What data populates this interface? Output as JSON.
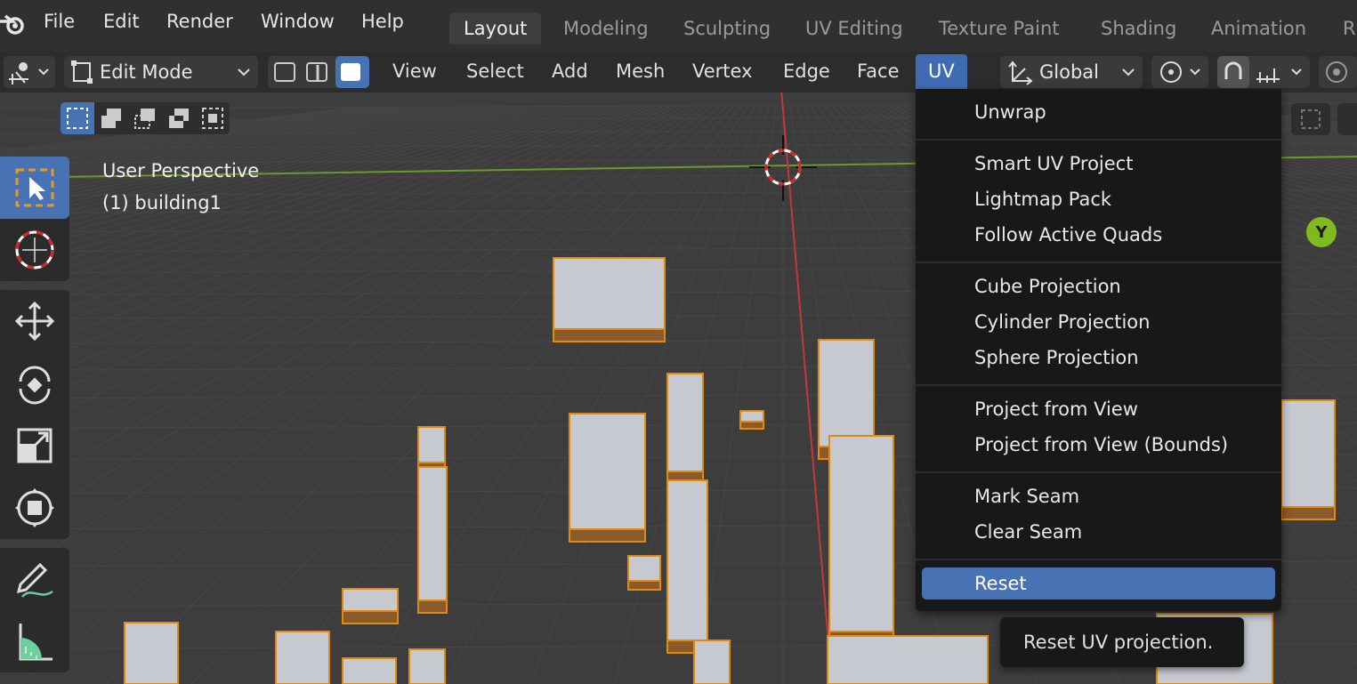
{
  "topbar": {
    "menus": [
      "File",
      "Edit",
      "Render",
      "Window",
      "Help"
    ],
    "workspaces": [
      "Layout",
      "Modeling",
      "Sculpting",
      "UV Editing",
      "Texture Paint",
      "Shading",
      "Animation",
      "R"
    ],
    "active_workspace": "Layout"
  },
  "header": {
    "mode": "Edit Mode",
    "menus": [
      "View",
      "Select",
      "Add",
      "Mesh",
      "Vertex",
      "Edge",
      "Face",
      "UV"
    ],
    "active_menu": "UV",
    "transform_orientation": "Global"
  },
  "viewport": {
    "view_name": "User Perspective",
    "object_label": "(1) building1",
    "axis_gizmo_label": "Y"
  },
  "uv_menu": {
    "groups": [
      [
        "Unwrap"
      ],
      [
        "Smart UV Project",
        "Lightmap Pack",
        "Follow Active Quads"
      ],
      [
        "Cube Projection",
        "Cylinder Projection",
        "Sphere Projection"
      ],
      [
        "Project from View",
        "Project from View (Bounds)"
      ],
      [
        "Mark Seam",
        "Clear Seam"
      ],
      [
        "Reset"
      ]
    ],
    "highlighted": "Reset"
  },
  "tooltip": {
    "text": "Reset UV projection."
  },
  "colors": {
    "accent": "#4772b3",
    "building_top": "#c7c9d1",
    "building_side": "#8a5a2b",
    "building_outline": "#e08a10",
    "x_axis": "#c7353b",
    "y_axis": "#7fbb1f"
  }
}
